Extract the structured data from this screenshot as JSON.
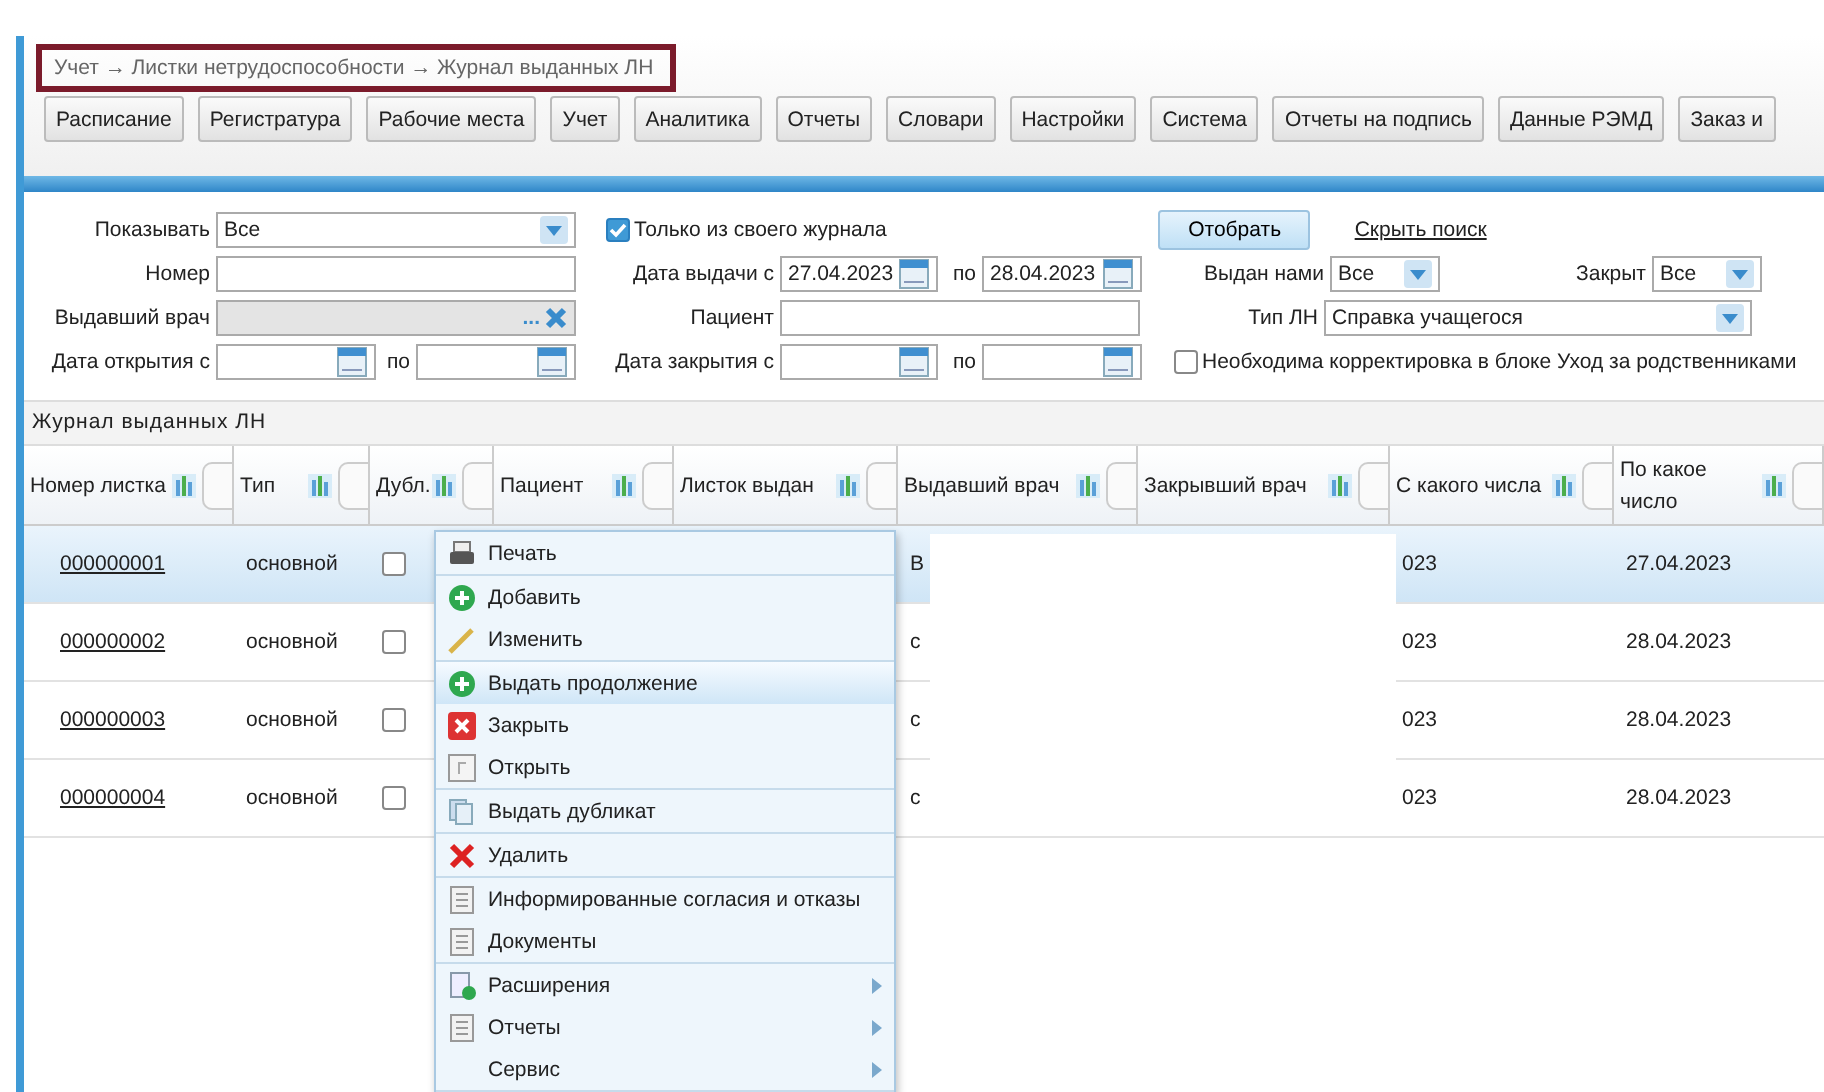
{
  "breadcrumb": "Учет → Листки нетрудоспособности → Журнал выданных ЛН",
  "nav_buttons": [
    "Расписание",
    "Регистратура",
    "Рабочие места",
    "Учет",
    "Аналитика",
    "Отчеты",
    "Словари",
    "Настройки",
    "Система",
    "Отчеты на подпись",
    "Данные РЭМД",
    "Заказ и"
  ],
  "filters": {
    "show": {
      "label": "Показывать",
      "value": "Все"
    },
    "number": {
      "label": "Номер"
    },
    "doctor": {
      "label": "Выдавший врач",
      "disabled": true,
      "browse": "..."
    },
    "open_date": {
      "label": "Дата открытия с",
      "to_label": "по"
    },
    "own_journal": {
      "label": "Только из своего журнала",
      "checked": true
    },
    "issue_date": {
      "label": "Дата выдачи с",
      "from": "27.04.2023",
      "to_label": "по",
      "to": "28.04.2023"
    },
    "patient": {
      "label": "Пациент"
    },
    "close_date": {
      "label": "Дата закрытия с",
      "to_label": "по"
    },
    "apply_button": "Отобрать",
    "hide_link": "Скрыть поиск",
    "issued_by_us": {
      "label": "Выдан нами",
      "value": "Все"
    },
    "closed": {
      "label": "Закрыт",
      "value": "Все"
    },
    "sheet_type": {
      "label": "Тип ЛН",
      "value": "Справка учащегося"
    },
    "needs_fix": {
      "label": "Необходима корректировка в блоке Уход за родственниками",
      "checked": false
    }
  },
  "table": {
    "title": "Журнал выданных ЛН",
    "columns": [
      "Номер листка",
      "Тип",
      "Дубл.",
      "Пациент",
      "Листок выдан",
      "Выдавший врач",
      "Закрывший врач",
      "С какого числа",
      "По какое число"
    ],
    "rows": [
      {
        "number": "000000001",
        "type": "основной",
        "duplicate": false,
        "doctor": "В",
        "from": "023",
        "to": "27.04.2023",
        "selected": true
      },
      {
        "number": "000000002",
        "type": "основной",
        "duplicate": false,
        "doctor": "с",
        "from": "023",
        "to": "28.04.2023",
        "selected": false
      },
      {
        "number": "000000003",
        "type": "основной",
        "duplicate": false,
        "doctor": "с",
        "from": "023",
        "to": "28.04.2023",
        "selected": false
      },
      {
        "number": "000000004",
        "type": "основной",
        "duplicate": false,
        "doctor": "с",
        "from": "023",
        "to": "28.04.2023",
        "selected": false
      }
    ]
  },
  "context_menu": {
    "groups": [
      [
        {
          "label": "Печать",
          "selected": false,
          "submenu": false
        }
      ],
      [
        {
          "label": "Добавить",
          "selected": false,
          "submenu": false
        },
        {
          "label": "Изменить",
          "selected": false,
          "submenu": false
        }
      ],
      [
        {
          "label": "Выдать продолжение",
          "selected": true,
          "submenu": false
        },
        {
          "label": "Закрыть",
          "selected": false,
          "submenu": false
        },
        {
          "label": "Открыть",
          "selected": false,
          "submenu": false
        }
      ],
      [
        {
          "label": "Выдать дубликат",
          "selected": false,
          "submenu": false
        }
      ],
      [
        {
          "label": "Удалить",
          "selected": false,
          "submenu": false
        }
      ],
      [
        {
          "label": "Информированные согласия и отказы",
          "selected": false,
          "submenu": false
        },
        {
          "label": "Документы",
          "selected": false,
          "submenu": false
        }
      ],
      [
        {
          "label": "Расширения",
          "selected": false,
          "submenu": true
        },
        {
          "label": "Отчеты",
          "selected": false,
          "submenu": true
        },
        {
          "label": "Сервис",
          "selected": false,
          "submenu": true
        }
      ]
    ]
  }
}
